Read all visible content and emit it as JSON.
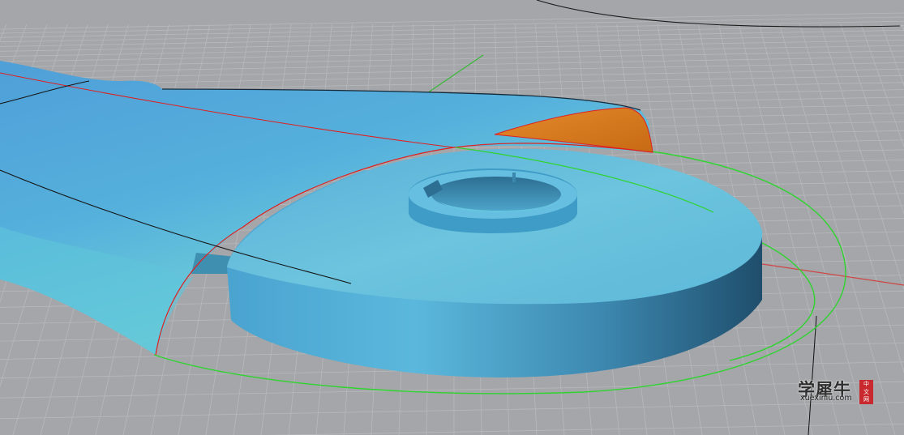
{
  "viewport": {
    "view": "perspective",
    "object": "blue ladle/spoon surface model with cylindrical base",
    "colors": {
      "background": "#a4a6a9",
      "grid": "#b7b9bc",
      "axis_x": "#d04545",
      "axis_y": "#38b838",
      "surface": "#5ab0d8",
      "selected_surface": "#e07a20",
      "edge_curve": "#e02020",
      "construction_curve": "#2fd42f",
      "black_curve": "#111111"
    }
  },
  "watermark": {
    "brand": "学犀牛",
    "url": "xuexiniu.com",
    "stamp": [
      "中",
      "文",
      "网"
    ]
  }
}
